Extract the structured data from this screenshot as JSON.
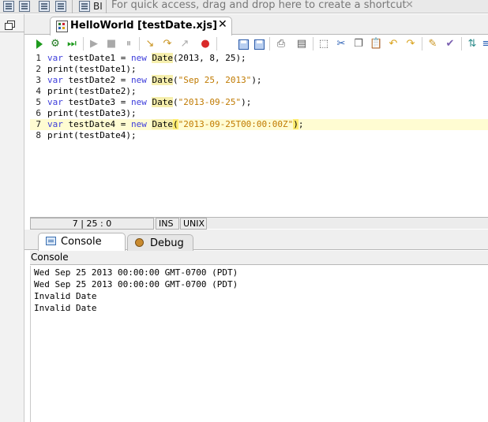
{
  "shortcut_bar": {
    "bi_label": "BI",
    "hint": "For quick access, drag and drop here to create a shortcut",
    "close_glyph": "✕"
  },
  "editor": {
    "tab_title": "HelloWorld [testDate.xjs]",
    "tab_close": "✕"
  },
  "code_lines": [
    {
      "num": "1",
      "parts": [
        {
          "t": "var",
          "c": "kw"
        },
        {
          "t": " testDate1 = "
        },
        {
          "t": "new",
          "c": "kw"
        },
        {
          "t": " "
        },
        {
          "t": "Date",
          "c": "cls"
        },
        {
          "t": "(2013, 8, 25);"
        }
      ]
    },
    {
      "num": "2",
      "parts": [
        {
          "t": "print(testDate1);"
        }
      ]
    },
    {
      "num": "3",
      "parts": [
        {
          "t": "var",
          "c": "kw"
        },
        {
          "t": " testDate2 = "
        },
        {
          "t": "new",
          "c": "kw"
        },
        {
          "t": " "
        },
        {
          "t": "Date",
          "c": "cls"
        },
        {
          "t": "("
        },
        {
          "t": "\"Sep 25, 2013\"",
          "c": "str"
        },
        {
          "t": ");"
        }
      ]
    },
    {
      "num": "4",
      "parts": [
        {
          "t": "print(testDate2);"
        }
      ]
    },
    {
      "num": "5",
      "parts": [
        {
          "t": "var",
          "c": "kw"
        },
        {
          "t": " testDate3 = "
        },
        {
          "t": "new",
          "c": "kw"
        },
        {
          "t": " "
        },
        {
          "t": "Date",
          "c": "cls"
        },
        {
          "t": "("
        },
        {
          "t": "\"2013-09-25\"",
          "c": "str"
        },
        {
          "t": ");"
        }
      ]
    },
    {
      "num": "6",
      "parts": [
        {
          "t": "print(testDate3);"
        }
      ]
    },
    {
      "num": "7",
      "current": true,
      "parts": [
        {
          "t": "var",
          "c": "kw"
        },
        {
          "t": " testDate4 = "
        },
        {
          "t": "new",
          "c": "kw"
        },
        {
          "t": " "
        },
        {
          "t": "Date",
          "c": "cls"
        },
        {
          "t": "(",
          "c": "pm"
        },
        {
          "t": "\"2013-09-25T00:00:00Z\"",
          "c": "str"
        },
        {
          "t": ")",
          "c": "pm"
        },
        {
          "t": ";"
        }
      ]
    },
    {
      "num": "8",
      "parts": [
        {
          "t": "print(testDate4);"
        }
      ]
    }
  ],
  "status_bar": {
    "position": "7 | 25 : 0",
    "mode": "INS",
    "line_endings": "UNIX"
  },
  "panel": {
    "tabs": [
      {
        "label": "Console",
        "icon": "console-icon",
        "active": true
      },
      {
        "label": "Debug",
        "icon": "debug-icon",
        "active": false
      }
    ],
    "header": "Console",
    "output": [
      "Wed Sep 25 2013 00:00:00 GMT-0700 (PDT)",
      "Wed Sep 25 2013 00:00:00 GMT-0700 (PDT)",
      "Invalid Date",
      "Invalid Date"
    ]
  },
  "colors": {
    "keyword": "#3d3ddb",
    "string": "#c07a00",
    "class_highlight": "#f6efad",
    "current_line": "#fffcd2",
    "run_green": "#1d9a1d"
  }
}
